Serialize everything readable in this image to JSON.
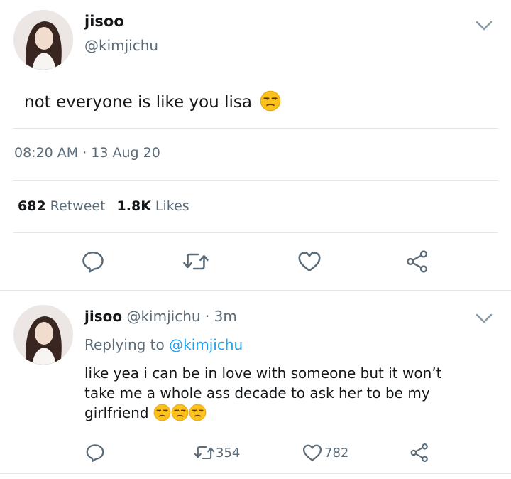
{
  "tweet": {
    "display_name": "jisoo",
    "handle": "@kimjichu",
    "text": "not everyone is like you lisa",
    "emoji": "unamused-face",
    "timestamp": "08:20 AM · 13 Aug 20",
    "retweet_count": "682",
    "retweet_label": "Retweet",
    "like_count": "1.8K",
    "like_label": "Likes"
  },
  "reply": {
    "display_name": "jisoo",
    "handle": "@kimjichu",
    "time": "· 3m",
    "replying_prefix": "Replying to",
    "replying_handle": "@kimjichu",
    "line1": "like yea i can be in love with someone but it won’t",
    "line2": "take me a whole ass decade to ask her to be my",
    "line3": "girlfriend",
    "retweet_count": "354",
    "like_count": "782"
  },
  "colors": {
    "link": "#1da1f2",
    "muted": "#5b6b78",
    "divider": "#e1e8ed"
  }
}
